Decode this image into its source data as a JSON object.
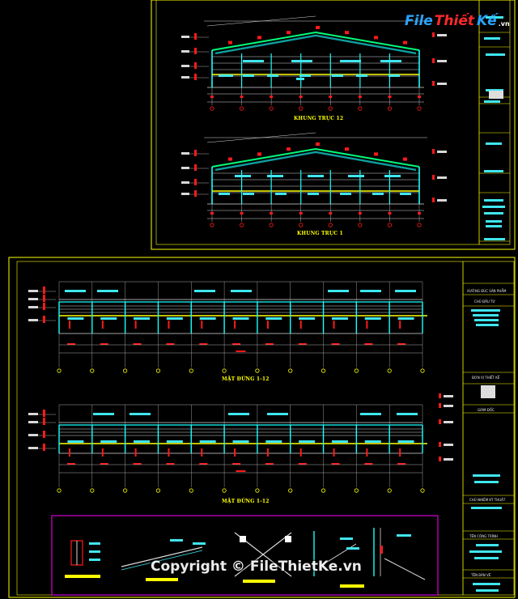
{
  "brand": {
    "logo_file": "File",
    "logo_thiet": "Thiết",
    "logo_ke": "Kế",
    "logo_vn": ".vn"
  },
  "watermark": "Copyright © FileThietKe.vn",
  "sheets": {
    "top": {
      "frame1_title": "KHUNG TRỤC 12",
      "frame2_title": "KHUNG TRỤC 1"
    },
    "bottom": {
      "elev1_title": "MẶT ĐỨNG 1-12",
      "elev2_title": "MẶT ĐỨNG 1-12",
      "title_block": {
        "project": "XƯỞNG ĐÚC SẢN PHẨM",
        "owner": "CHỦ ĐẦU TƯ",
        "unit": "ĐƠN VỊ THIẾT KẾ",
        "manager": "GIÁM ĐỐC",
        "chief": "CHỦ NHIỆM KỸ THUẬT",
        "work": "TÊN CÔNG TRÌNH",
        "drawing": "TÊN BẢN VẼ"
      }
    }
  },
  "colors": {
    "frame": "#18ffff",
    "roof": "#00ff7a",
    "dim_white": "#d8d8d8",
    "tag_red": "#ff1a1a",
    "tag_cyan": "#3fe6ee",
    "beam_yellow": "#ffff00",
    "sheet_border": "#ffff00",
    "detail_border": "#ff00ff"
  }
}
